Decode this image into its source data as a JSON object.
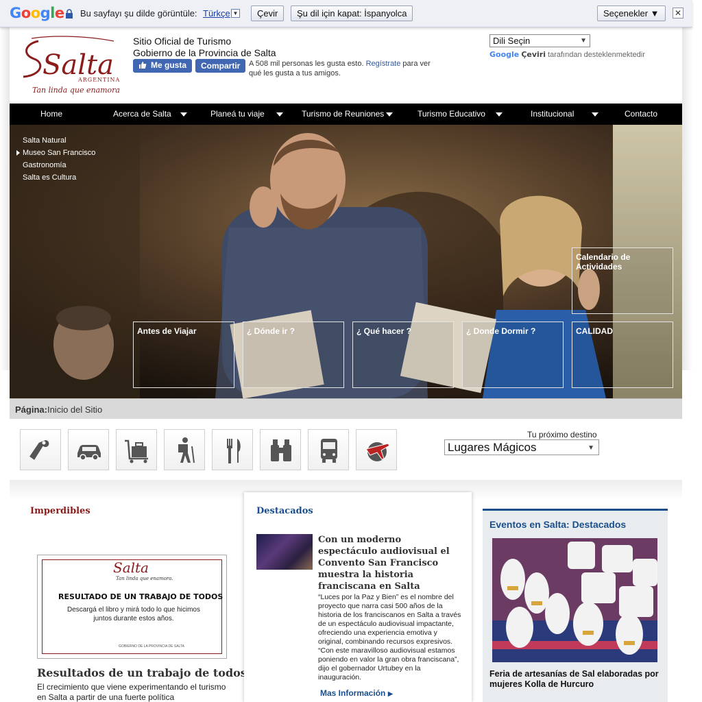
{
  "translate_bar": {
    "logo": "Google",
    "prompt": "Bu sayfayı şu dilde görüntüle:",
    "language": "Türkçe",
    "translate_btn": "Çevir",
    "disable_btn": "Şu dil için kapat: İspanyolca",
    "options_btn": "Seçenekler ▼",
    "close": "✕"
  },
  "header": {
    "logo_text": "Salta",
    "logo_country": "ARGENTINA",
    "logo_tagline": "Tan linda que enamora",
    "title_line1": "Sitio Oficial de Turismo",
    "title_line2": "Gobierno de la Provincia de Salta",
    "fb_like": "Me gusta",
    "fb_share": "Compartir",
    "fb_count": "A 508 mil personas les gusta esto.",
    "fb_register": "Regístrate",
    "fb_rest": "para ver qué les gusta a tus amigos.",
    "lang_select": "Dili Seçin",
    "powered_google": "Google",
    "powered_ceviri": "Çeviri",
    "powered_rest": "tarafından desteklenmektedir"
  },
  "nav": {
    "items": [
      "Home",
      "Acerca de Salta",
      "Planeá tu viaje",
      "Turismo de Reuniones",
      "Turismo Educativo",
      "Institucional",
      "Contacto"
    ]
  },
  "hero": {
    "submenu": [
      "Salta Natural",
      "Museo San Francisco",
      "Gastronomía",
      "Salta es Cultura"
    ],
    "calendar": "Calendario de Actividades",
    "boxes": [
      "Antes de Viajar",
      "¿ Dónde ir ?",
      "¿ Qué hacer ?",
      "¿ Donde Dormir ?",
      "CALIDAD"
    ]
  },
  "pagebar": {
    "label": "Página:",
    "value": "Inicio del Sitio"
  },
  "icons": [
    "door-hanger-icon",
    "car-icon",
    "luggage-icon",
    "hiker-icon",
    "fork-knife-icon",
    "binoculars-icon",
    "bus-icon",
    "plane-globe-icon"
  ],
  "destination": {
    "label": "Tu próximo destino",
    "value": "Lugares Mágicos"
  },
  "imperdibles": {
    "title": "Imperdibles",
    "card_logo": "Salta",
    "card_tagline": "Tan linda que enamora.",
    "card_title": "RESULTADO DE UN TRABAJO DE TODOS",
    "card_sub": "Descargá el libro y mirá todo lo que hicimos juntos durante estos años.",
    "card_footer": "GOBIERNO DE LA PROVINCIA DE SALTA",
    "heading": "Resultados de un trabajo de todos",
    "text": "El crecimiento que viene experimentando el turismo en Salta a partir de una fuerte política"
  },
  "destacados": {
    "title": "Destacados",
    "headline": "Con un moderno espectáculo audiovisual el Convento San Francisco muestra la historia franciscana en Salta",
    "body": "“Luces por la Paz y Bien” es el nombre del proyecto que narra casi 500 años de la historia de los franciscanos en Salta a través de un espectáculo audiovisual impactante, ofreciendo una experiencia emotiva y original, combinando recursos expresivos. “Con este maravilloso audiovisual estamos poniendo en valor la gran obra franciscana”, dijo el gobernador Urtubey en la inauguración.",
    "more": "Mas Información"
  },
  "eventos": {
    "title": "Eventos en Salta: Destacados",
    "caption": "Feria de artesanías de Sal elaboradas por mujeres Kolla de Hurcuro"
  },
  "colors": {
    "nav_bg": "#000000",
    "fb_blue": "#4267b2",
    "maroon": "#8a1c1c",
    "link_blue": "#1b4f8c"
  }
}
